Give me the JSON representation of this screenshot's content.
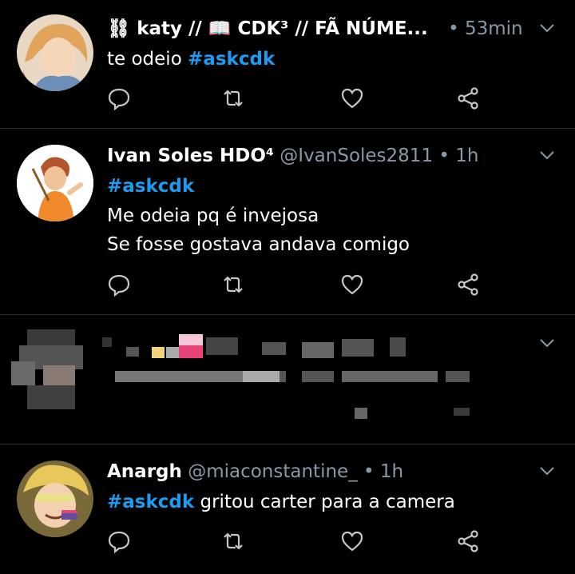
{
  "tweets": [
    {
      "name": "⛓ katy // 📖 CDK³ // FÃ NÚME...",
      "handle": "",
      "separator": "•",
      "time": "53min",
      "lines": [
        {
          "text": "te odeio ",
          "hashtag": "#askcdk",
          "after": ""
        }
      ]
    },
    {
      "name": "Ivan Soles HDO⁴",
      "handle": "@IvanSoles2811",
      "separator": "•",
      "time": "1h",
      "lines": [
        {
          "text": "",
          "hashtag": "#askcdk",
          "after": ""
        },
        {
          "text": "Me odeia pq é invejosa",
          "hashtag": "",
          "after": ""
        },
        {
          "text": "Se fosse gostava andava comigo",
          "hashtag": "",
          "after": ""
        }
      ]
    },
    {
      "name": "Anargh",
      "handle": "@miaconstantine_",
      "separator": "•",
      "time": "1h",
      "lines": [
        {
          "text": "",
          "hashtag": "#askcdk",
          "after": " gritou carter para a camera"
        }
      ]
    }
  ],
  "icons": {
    "reply": "reply-icon",
    "retweet": "retweet-icon",
    "like": "heart-icon",
    "share": "share-icon",
    "menu": "chevron-down-icon"
  },
  "colors": {
    "background": "#000000",
    "text": "#ffffff",
    "muted": "#8b98a5",
    "hashtag": "#1d9bf0",
    "separator": "#2f2f2f"
  }
}
